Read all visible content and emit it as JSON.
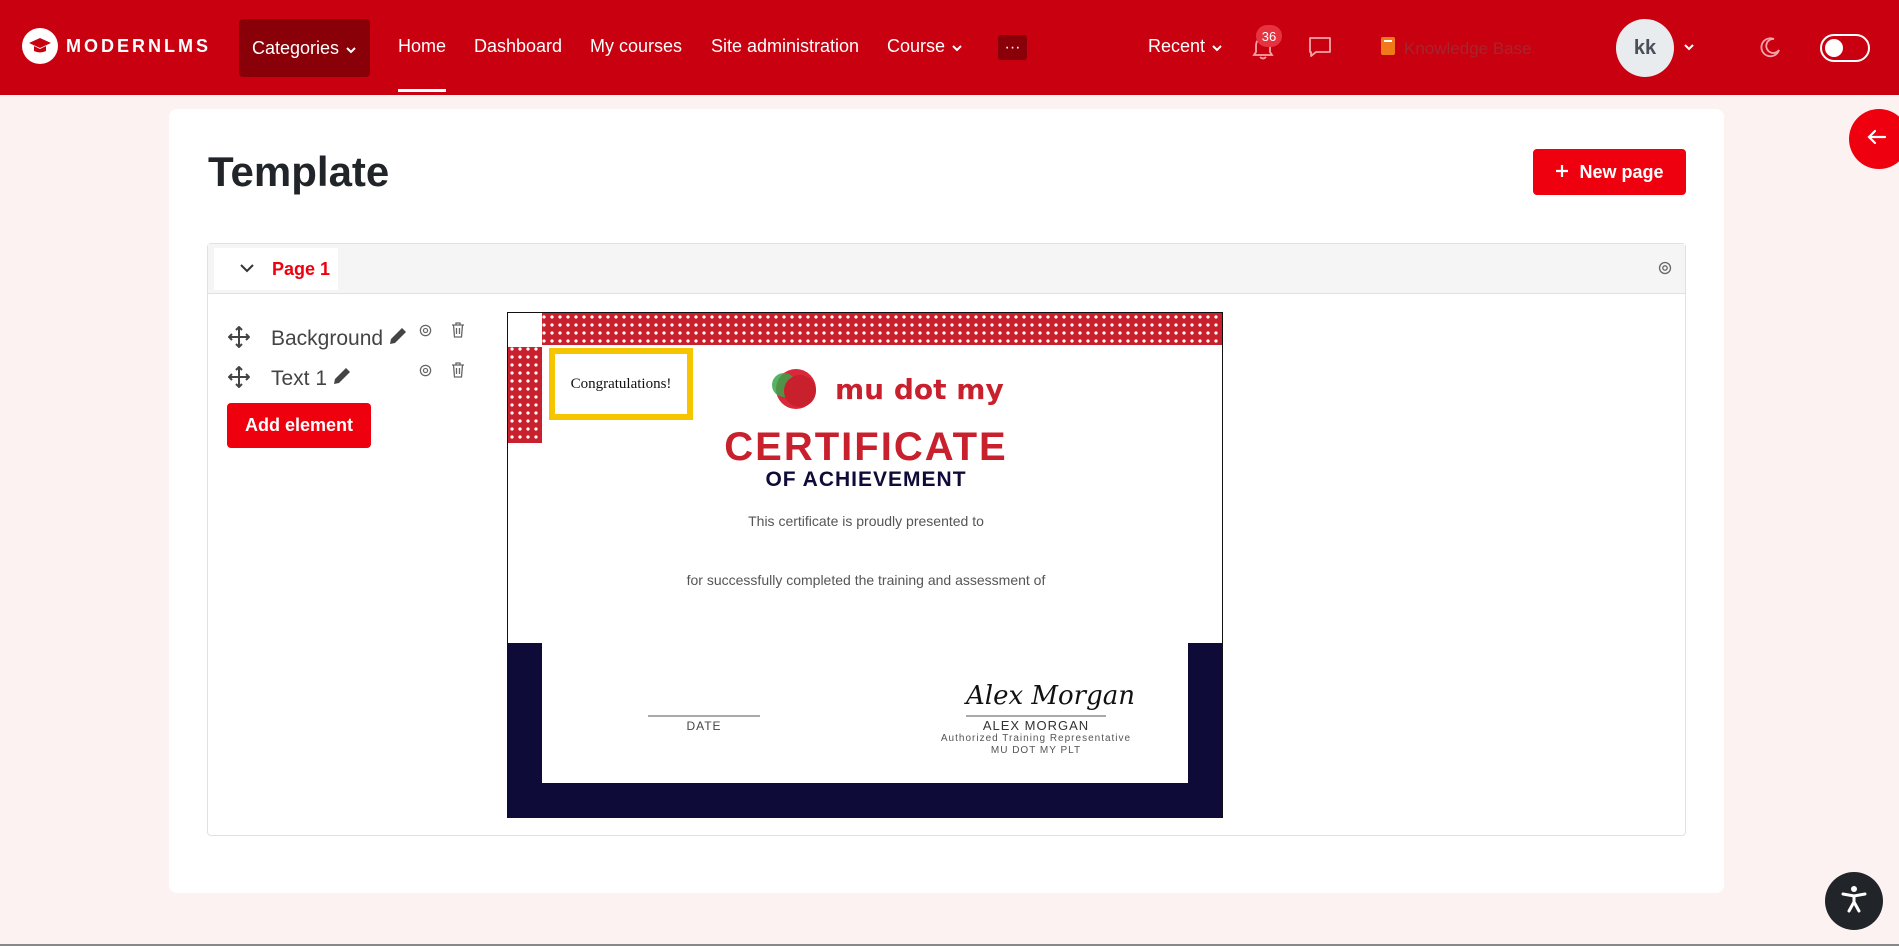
{
  "navbar": {
    "brand": "MODERNLMS",
    "categories_label": "Categories",
    "links": [
      {
        "label": "Home",
        "active": true
      },
      {
        "label": "Dashboard"
      },
      {
        "label": "My courses"
      },
      {
        "label": "Site administration"
      },
      {
        "label": "Course"
      }
    ],
    "more_label": "···",
    "recent_label": "Recent",
    "notification_count": "36",
    "knowledge_base_label": "Knowledge Base",
    "avatar_initials": "kk",
    "colors": {
      "bar": "#c8000f",
      "accent": "#ee000e"
    }
  },
  "main": {
    "title": "Template",
    "new_page_label": "New page",
    "page_tab_label": "Page 1",
    "elements": [
      {
        "label": "Background"
      },
      {
        "label": "Text 1"
      }
    ],
    "add_element_label": "Add element"
  },
  "certificate": {
    "text_element": "Congratulations!",
    "brand": "mu dot my",
    "heading": "CERTIFICATE",
    "subheading": "OF ACHIEVEMENT",
    "presented_line": "This certificate is proudly presented to",
    "completion_line": "for successfully completed the training and assessment of",
    "date_label": "DATE",
    "signature": "Alex Morgan",
    "signer_name": "ALEX MORGAN",
    "signer_role": "Authorized Training Representative",
    "signer_org": "MU DOT MY PLT",
    "colors": {
      "red": "#c8202c",
      "navy": "#0e0b38",
      "highlight": "#f7c500"
    }
  }
}
